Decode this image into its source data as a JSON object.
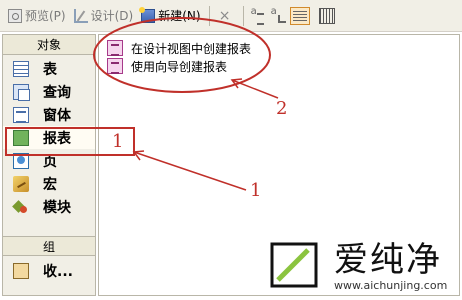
{
  "toolbar": {
    "preview_label": "预览(P)",
    "design_label": "设计(D)",
    "new_label": "新建(N)",
    "delete_icon": "×"
  },
  "objects_header": "对象",
  "object_items": [
    {
      "label": "表",
      "icon": "table-icon"
    },
    {
      "label": "查询",
      "icon": "query-icon"
    },
    {
      "label": "窗体",
      "icon": "form-icon"
    },
    {
      "label": "报表",
      "icon": "report-icon"
    },
    {
      "label": "页",
      "icon": "page-icon"
    },
    {
      "label": "宏",
      "icon": "macro-icon"
    },
    {
      "label": "模块",
      "icon": "module-icon"
    }
  ],
  "groups_header": "组",
  "favorites_label": "收...",
  "list_items": [
    {
      "label": "在设计视图中创建报表"
    },
    {
      "label": "使用向导创建报表"
    }
  ],
  "annotations": {
    "label_1a": "1",
    "label_1b": "1",
    "label_2": "2",
    "color": "#c0302a"
  },
  "watermark": {
    "text": "爱纯净",
    "url": "www.aichunjing.com"
  }
}
